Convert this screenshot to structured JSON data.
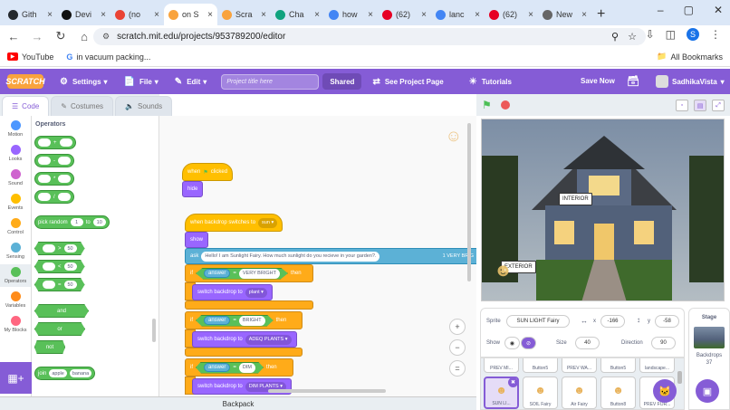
{
  "browser": {
    "tabs": [
      {
        "title": "Gith",
        "color": "#24292e"
      },
      {
        "title": "Devi",
        "color": "#111"
      },
      {
        "title": "(no",
        "color": "#ea4335"
      },
      {
        "title": "on S",
        "color": "#f9a33d"
      },
      {
        "title": "Scra",
        "color": "#f9a33d"
      },
      {
        "title": "Cha",
        "color": "#10a37f"
      },
      {
        "title": "how",
        "color": "#4285f4"
      },
      {
        "title": "(62)",
        "color": "#e60023"
      },
      {
        "title": "lanc",
        "color": "#4285f4"
      },
      {
        "title": "(62)",
        "color": "#e60023"
      },
      {
        "title": "New",
        "color": "#666"
      }
    ],
    "active_tab_index": 3,
    "new_tab_symbol": "+",
    "url": "scratch.mit.edu/projects/953789200/editor",
    "profile_initial": "S",
    "bookmarks": [
      {
        "label": "YouTube"
      },
      {
        "label": "in vacuum packing..."
      }
    ],
    "all_bookmarks": "All Bookmarks"
  },
  "menubar": {
    "logo": "SCRATCH",
    "settings": "Settings",
    "file": "File",
    "edit": "Edit",
    "title_placeholder": "Project title here",
    "shared": "Shared",
    "see_project": "See Project Page",
    "tutorials": "Tutorials",
    "save_now": "Save Now",
    "username": "SadhikaVista"
  },
  "editor_tabs": {
    "code": "Code",
    "costumes": "Costumes",
    "sounds": "Sounds"
  },
  "categories": [
    {
      "label": "Motion",
      "color": "#4c97ff"
    },
    {
      "label": "Looks",
      "color": "#9966ff"
    },
    {
      "label": "Sound",
      "color": "#cf63cf"
    },
    {
      "label": "Events",
      "color": "#ffbf00"
    },
    {
      "label": "Control",
      "color": "#ffab19"
    },
    {
      "label": "Sensing",
      "color": "#5cb1d6"
    },
    {
      "label": "Operators",
      "color": "#59c059"
    },
    {
      "label": "Variables",
      "color": "#ff8c1a"
    },
    {
      "label": "My Blocks",
      "color": "#ff6680"
    }
  ],
  "selected_category": "Operators",
  "palette": {
    "title": "Operators",
    "ops": [
      "+",
      "-",
      "*",
      "/"
    ],
    "pick_random": {
      "label": "pick random",
      "a": "1",
      "to": "to",
      "b": "10"
    },
    "compare": [
      {
        "op": ">",
        "val": "50"
      },
      {
        "op": "<",
        "val": "50"
      },
      {
        "op": "=",
        "val": "50"
      }
    ],
    "and": "and",
    "or": "or",
    "not": "not",
    "join": {
      "label": "join",
      "a": "apple",
      "b": "banana"
    }
  },
  "script": {
    "when_flag": "when",
    "clicked": "clicked",
    "hide": "hide",
    "when_backdrop": "when backdrop switches to",
    "backdrop_value": "sun",
    "show": "show",
    "ask": "ask",
    "ask_text": "Hello! I am Sunlight Fairy. How much sunlight do you recieve in your garden?.",
    "ask_overflow": "1 VERY BRIG",
    "if": "if",
    "then": "then",
    "answer": "answer",
    "eq": "=",
    "conditions": [
      {
        "value": "VERY BRIGHT",
        "switch_to": "plant"
      },
      {
        "value": "BRIGHT",
        "switch_to": "ADEQ PLANTS"
      },
      {
        "value": "DIM",
        "switch_to": "DIM PLANTS"
      }
    ],
    "switch_backdrop": "switch backdrop to"
  },
  "zoom": {
    "in": "+",
    "out": "−",
    "reset": "="
  },
  "backpack": "Backpack",
  "stage_labels": {
    "interior": "INTERIOR",
    "exterior": "EXTERIOR"
  },
  "sprite_info": {
    "sprite_label": "Sprite",
    "sprite_name": "SUN LIGHT Fairy",
    "x_label": "x",
    "x": "-166",
    "y_label": "y",
    "y": "-58",
    "show_label": "Show",
    "size_label": "Size",
    "size": "40",
    "direction_label": "Direction",
    "direction": "90"
  },
  "sprites_row1": [
    "PREV MI...",
    "Button5",
    "PREV WA...",
    "Button5",
    "landscape..."
  ],
  "sprites_row2": [
    "SUN LI...",
    "SOIL Fairy",
    "Air Fairy",
    "Button8",
    "PREV FOR..."
  ],
  "stage_panel": {
    "title": "Stage",
    "backdrops_label": "Backdrops",
    "backdrops_count": "37"
  }
}
